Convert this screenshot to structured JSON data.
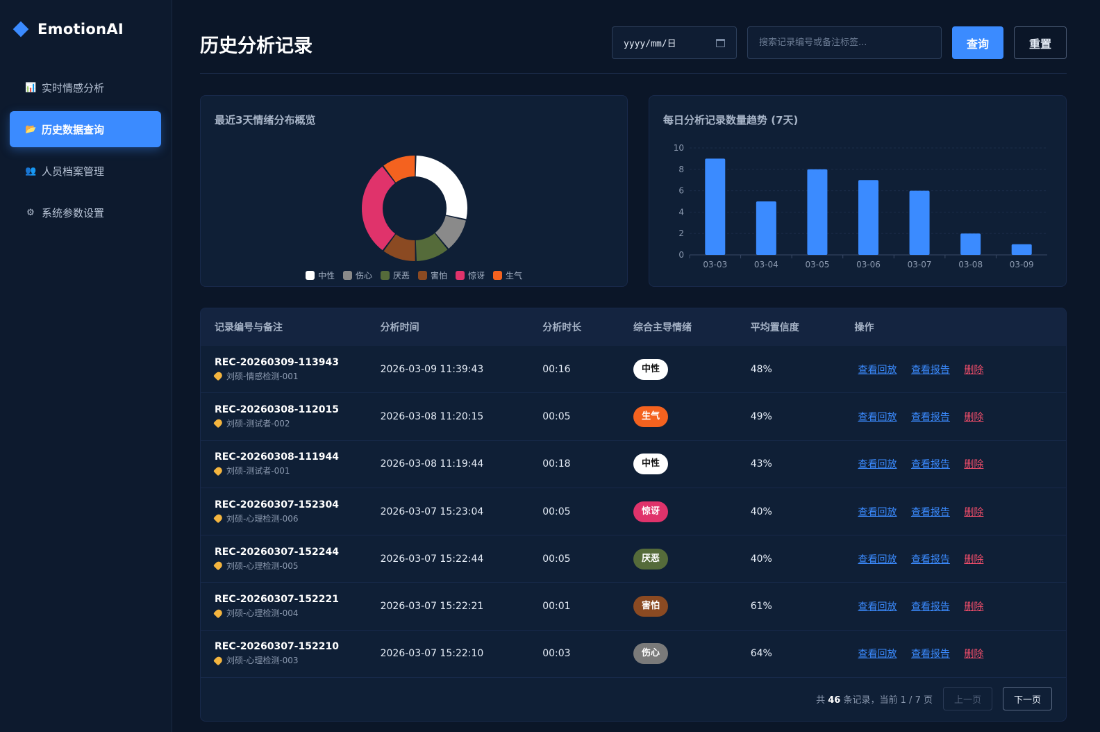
{
  "brand": {
    "name": "EmotionAI",
    "accent": "#3b8bff"
  },
  "sidebar": {
    "items": [
      {
        "icon": "bar-chart-icon",
        "glyph": "📊",
        "label": "实时情感分析",
        "active": false
      },
      {
        "icon": "folder-icon",
        "glyph": "📂",
        "label": "历史数据查询",
        "active": true
      },
      {
        "icon": "users-icon",
        "glyph": "👥",
        "label": "人员档案管理",
        "active": false
      },
      {
        "icon": "gear-icon",
        "glyph": "⚙",
        "label": "系统参数设置",
        "active": false
      }
    ]
  },
  "header": {
    "title": "历史分析记录",
    "date_placeholder": "yyyy/mm/日",
    "search_placeholder": "搜索记录编号或备注标签...",
    "query_label": "查询",
    "reset_label": "重置"
  },
  "donut_card": {
    "title": "最近3天情绪分布概览"
  },
  "bar_card": {
    "title": "每日分析记录数量趋势 (7天)"
  },
  "chart_data": [
    {
      "type": "pie",
      "donut": true,
      "categories": [
        "中性",
        "伤心",
        "厌恶",
        "害怕",
        "惊讶",
        "生气"
      ],
      "values": [
        4,
        1.5,
        1.5,
        1.5,
        4.2,
        1.5
      ],
      "colors": [
        "#ffffff",
        "#8a8a8a",
        "#556b3a",
        "#8b4a22",
        "#e0336b",
        "#f4621f"
      ],
      "legend": "bottom"
    },
    {
      "type": "bar",
      "categories": [
        "03-03",
        "03-04",
        "03-05",
        "03-06",
        "03-07",
        "03-08",
        "03-09"
      ],
      "values": [
        9,
        5,
        8,
        7,
        6,
        2,
        1
      ],
      "ylim": [
        0,
        10
      ],
      "yticks": [
        0,
        2,
        4,
        6,
        8,
        10
      ],
      "color": "#3b8bff",
      "grid": true
    }
  ],
  "table": {
    "headers": [
      "记录编号与备注",
      "分析时间",
      "分析时长",
      "综合主导情绪",
      "平均置信度",
      "操作"
    ],
    "actions": {
      "replay": "查看回放",
      "report": "查看报告",
      "delete": "删除"
    },
    "rows": [
      {
        "id": "REC-20260309-113943",
        "note": "刘硕-情感检测-001",
        "time": "2026-03-09 11:39:43",
        "duration": "00:16",
        "emotion": "中性",
        "emotion_bg": "#ffffff",
        "emotion_fg": "#111111",
        "confidence": "48%"
      },
      {
        "id": "REC-20260308-112015",
        "note": "刘硕-测试者-002",
        "time": "2026-03-08 11:20:15",
        "duration": "00:05",
        "emotion": "生气",
        "emotion_bg": "#f4621f",
        "emotion_fg": "#ffffff",
        "confidence": "49%"
      },
      {
        "id": "REC-20260308-111944",
        "note": "刘硕-测试者-001",
        "time": "2026-03-08 11:19:44",
        "duration": "00:18",
        "emotion": "中性",
        "emotion_bg": "#ffffff",
        "emotion_fg": "#111111",
        "confidence": "43%"
      },
      {
        "id": "REC-20260307-152304",
        "note": "刘硕-心理检测-006",
        "time": "2026-03-07 15:23:04",
        "duration": "00:05",
        "emotion": "惊讶",
        "emotion_bg": "#e0336b",
        "emotion_fg": "#ffffff",
        "confidence": "40%"
      },
      {
        "id": "REC-20260307-152244",
        "note": "刘硕-心理检测-005",
        "time": "2026-03-07 15:22:44",
        "duration": "00:05",
        "emotion": "厌恶",
        "emotion_bg": "#556b3a",
        "emotion_fg": "#ffffff",
        "confidence": "40%"
      },
      {
        "id": "REC-20260307-152221",
        "note": "刘硕-心理检测-004",
        "time": "2026-03-07 15:22:21",
        "duration": "00:01",
        "emotion": "害怕",
        "emotion_bg": "#8b4a22",
        "emotion_fg": "#ffffff",
        "confidence": "61%"
      },
      {
        "id": "REC-20260307-152210",
        "note": "刘硕-心理检测-003",
        "time": "2026-03-07 15:22:10",
        "duration": "00:03",
        "emotion": "伤心",
        "emotion_bg": "#7a7a7a",
        "emotion_fg": "#ffffff",
        "confidence": "64%"
      }
    ]
  },
  "pagination": {
    "prefix": "共",
    "total": "46",
    "middle": "条记录，当前",
    "current": "1 / 7",
    "suffix": "页",
    "prev_label": "上一页",
    "next_label": "下一页"
  }
}
